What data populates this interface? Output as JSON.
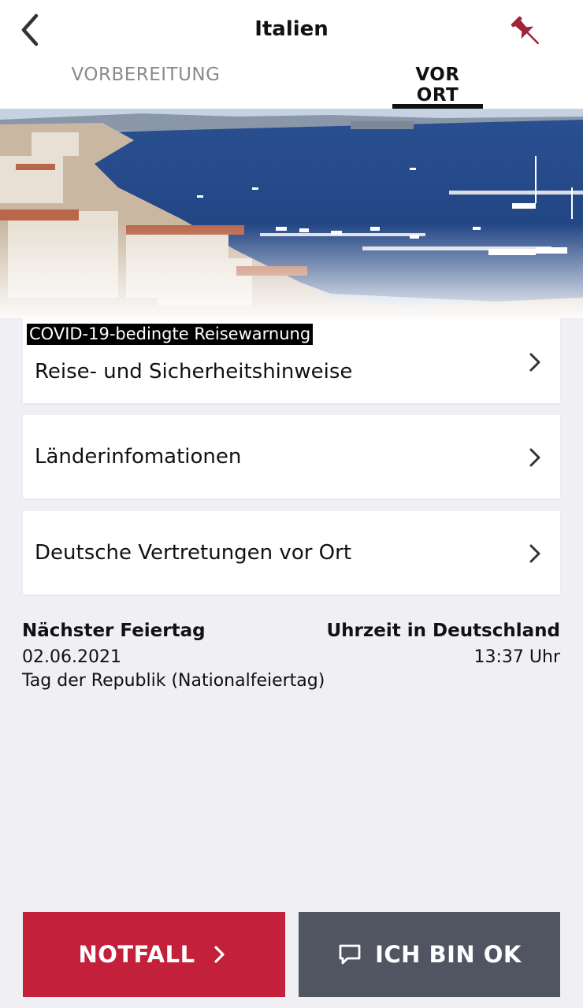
{
  "header": {
    "title": "Italien",
    "back_icon": "chevron-left-icon",
    "pin_icon": "pushpin-icon",
    "pin_color": "#a3203a"
  },
  "tabs": [
    {
      "label": "VORBEREITUNG",
      "active": false
    },
    {
      "label": "VOR ORT",
      "active": true
    }
  ],
  "hero": {
    "image": "coastal-city-harbor-photo"
  },
  "cards": [
    {
      "badge": "COVID-19-bedingte Reisewarnung",
      "label": "Reise- und Sicherheitshinweise"
    },
    {
      "label": "Länderinfomationen"
    },
    {
      "label": "Deutsche Vertretungen vor Ort"
    }
  ],
  "holiday": {
    "heading": "Nächster Feiertag",
    "date": "02.06.2021",
    "name": "Tag der Republik (Nationalfeiertag)"
  },
  "time_germany": {
    "heading": "Uhrzeit in Deutschland",
    "time": "13:37 Uhr"
  },
  "buttons": {
    "emergency_label": "NOTFALL",
    "emergency_color": "#c3213b",
    "ok_label": "ICH BIN OK",
    "ok_color": "#515562",
    "ok_icon": "chat-bubble-icon"
  }
}
